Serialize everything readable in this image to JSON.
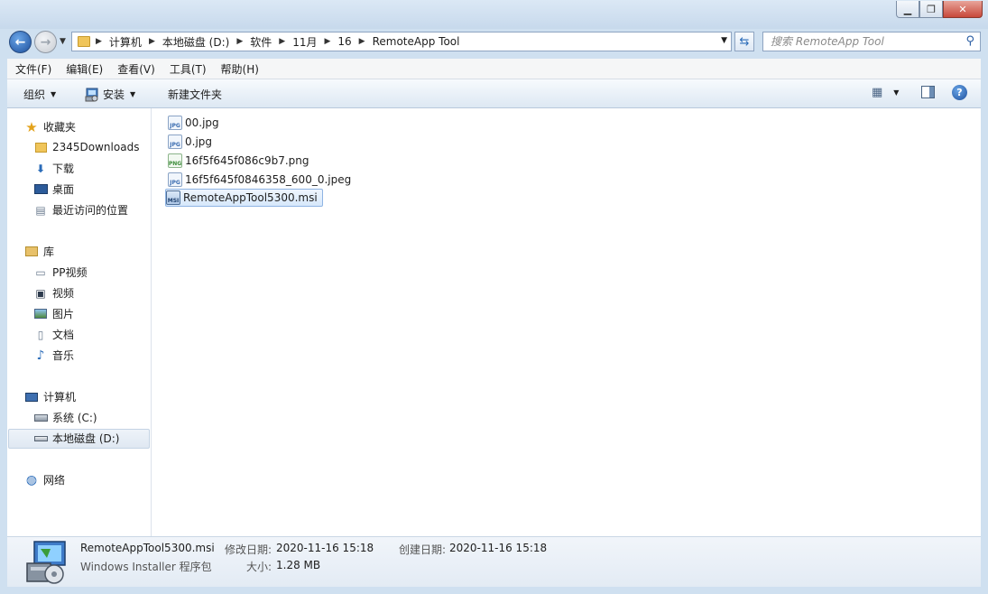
{
  "window": {
    "controls": {
      "minimize": "▁",
      "maximize": "❐",
      "close": "✕"
    }
  },
  "address": {
    "crumbs": [
      "计算机",
      "本地磁盘 (D:)",
      "软件",
      "11月",
      "16",
      "RemoteApp Tool"
    ],
    "search_placeholder": "搜索 RemoteApp Tool"
  },
  "menu": [
    "文件(F)",
    "编辑(E)",
    "查看(V)",
    "工具(T)",
    "帮助(H)"
  ],
  "toolbar": {
    "organize": "组织",
    "install": "安装",
    "new_folder": "新建文件夹"
  },
  "nav": {
    "favorites": "收藏夹",
    "fav_items": [
      "2345Downloads",
      "下载",
      "桌面",
      "最近访问的位置"
    ],
    "libraries": "库",
    "lib_items": [
      "PP视频",
      "视频",
      "图片",
      "文档",
      "音乐"
    ],
    "computer": "计算机",
    "drives": [
      "系统 (C:)",
      "本地磁盘 (D:)"
    ],
    "network": "网络"
  },
  "files": [
    {
      "name": "00.jpg",
      "type": "jpg"
    },
    {
      "name": "0.jpg",
      "type": "jpg"
    },
    {
      "name": "16f5f645f086c9b7.png",
      "type": "png"
    },
    {
      "name": "16f5f645f0846358_600_0.jpeg",
      "type": "jpg"
    },
    {
      "name": "RemoteAppTool5300.msi",
      "type": "msi"
    }
  ],
  "details": {
    "name": "RemoteAppTool5300.msi",
    "type": "Windows Installer 程序包",
    "modified_label": "修改日期:",
    "modified": "2020-11-16 15:18",
    "created_label": "创建日期:",
    "created": "2020-11-16 15:18",
    "size_label": "大小:",
    "size": "1.28 MB"
  },
  "colors": {
    "selection": "#d7e8fb",
    "chrome": "#cfe0f0"
  }
}
